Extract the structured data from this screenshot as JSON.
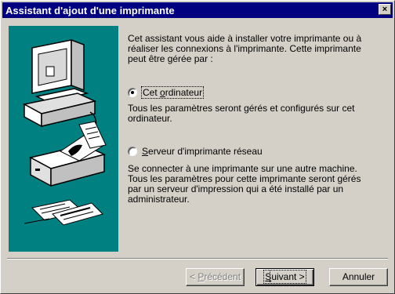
{
  "window": {
    "title": "Assistant d'ajout d'une imprimante",
    "close_glyph": "×"
  },
  "intro": {
    "line1": "Cet assistant vous aide à installer votre imprimante ou à",
    "line2": "réaliser les connexions à l'imprimante. Cette imprimante",
    "line3": "peut être gérée par :"
  },
  "options": [
    {
      "label_pre": "Cet ",
      "label_ul": "o",
      "label_post": "rdinateur",
      "checked": true,
      "desc_line1": "Tous les paramètres seront gérés et configurés sur cet",
      "desc_line2": "ordinateur."
    },
    {
      "label_pre": "",
      "label_ul": "S",
      "label_post": "erveur d'imprimante réseau",
      "checked": false,
      "desc_line1": "Se connecter à une imprimante sur une autre machine.",
      "desc_line2": "Tous les paramètres pour cette imprimante seront gérés",
      "desc_line3": "par un serveur d'impression qui a été installé par un",
      "desc_line4": "administrateur."
    }
  ],
  "buttons": {
    "back_pre": "< ",
    "back_ul": "P",
    "back_post": "récédent",
    "next_ul": "S",
    "next_post": "uivant >",
    "cancel": "Annuler"
  },
  "icons": [
    "close-icon",
    "computer-printer-illustration",
    "radio-checked-icon",
    "radio-unchecked-icon"
  ]
}
